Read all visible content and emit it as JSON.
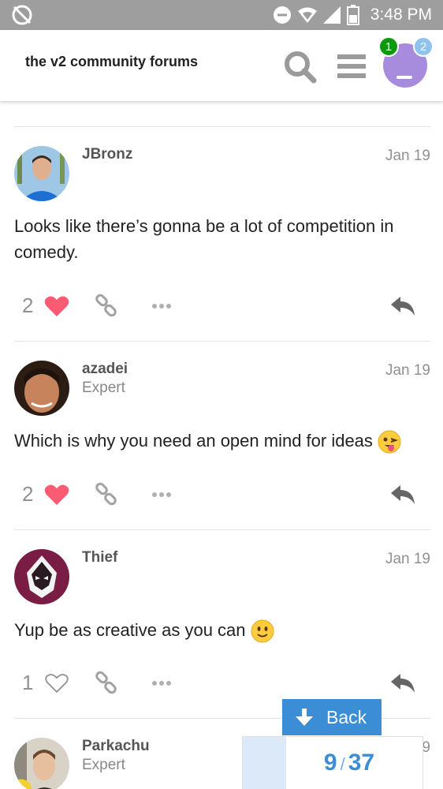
{
  "status_bar": {
    "time": "3:48 PM",
    "icons": [
      "no-sync-icon",
      "do-not-disturb-icon",
      "wifi-icon",
      "signal-icon",
      "battery-icon"
    ]
  },
  "header": {
    "title": "the v2 community forums",
    "notifications_badge": "1",
    "messages_badge": "2",
    "colors": {
      "avatar": "#a78cde",
      "green_badge": "#0a9a0a",
      "blue_badge": "#8fc2ec"
    }
  },
  "posts": [
    {
      "username": "JBronz",
      "user_title": "",
      "date": "Jan 19",
      "body": "Looks like there’s gonna be a lot of competition in comedy.",
      "likes": "2",
      "liked": true
    },
    {
      "username": "azadei",
      "user_title": "Expert",
      "date": "Jan 19",
      "body": "Which is why you need an open mind for ideas",
      "emoji": "winking-tongue-emoji",
      "likes": "2",
      "liked": true
    },
    {
      "username": "Thief",
      "user_title": "",
      "date": "Jan 19",
      "body": "Yup be as creative as you can",
      "emoji": "slight-smile-emoji",
      "likes": "1",
      "liked": false
    },
    {
      "username": "Parkachu",
      "user_title": "Expert",
      "date": "Jan 19"
    }
  ],
  "navigation": {
    "back_label": "Back",
    "current_post": "9",
    "total_posts": "37",
    "progress_fraction": 0.243,
    "accent_color": "#3b8dd5",
    "like_color": "#fb5c73"
  }
}
